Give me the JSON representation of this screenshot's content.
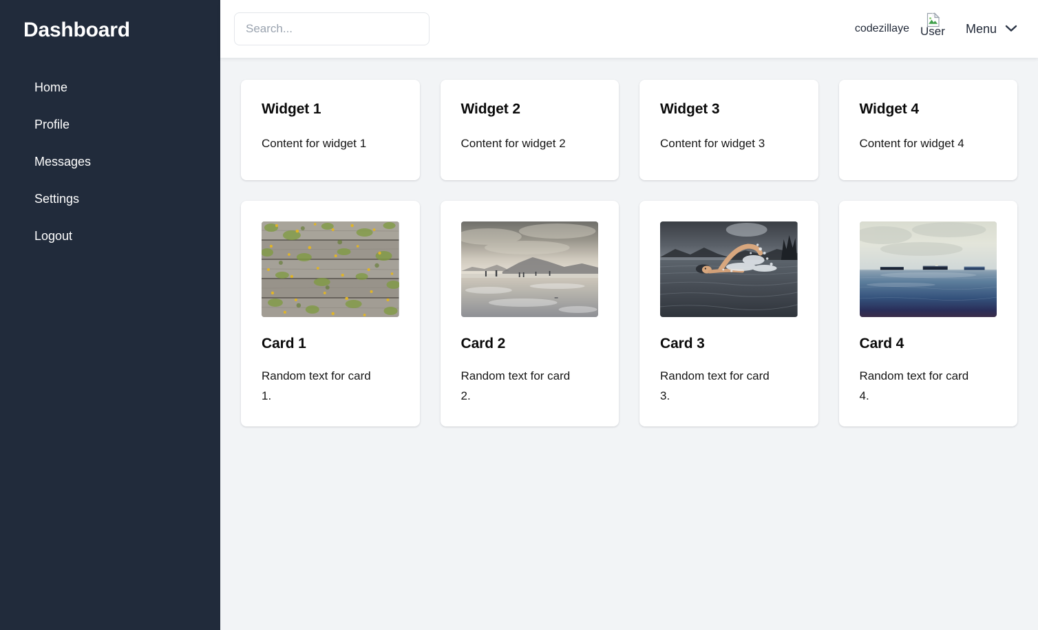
{
  "sidebar": {
    "title": "Dashboard",
    "items": [
      {
        "label": "Home"
      },
      {
        "label": "Profile"
      },
      {
        "label": "Messages"
      },
      {
        "label": "Settings"
      },
      {
        "label": "Logout"
      }
    ]
  },
  "header": {
    "search": {
      "placeholder": "Search...",
      "value": ""
    },
    "username": "codezillaye",
    "avatar": {
      "alt_text": "User",
      "icon": "broken-image-icon"
    },
    "menu": {
      "label": "Menu",
      "icon": "chevron-down-icon"
    }
  },
  "widgets": [
    {
      "title": "Widget 1",
      "body": "Content for widget 1"
    },
    {
      "title": "Widget 2",
      "body": "Content for widget 2"
    },
    {
      "title": "Widget 3",
      "body": "Content for widget 3"
    },
    {
      "title": "Widget 4",
      "body": "Content for widget 4"
    }
  ],
  "cards": [
    {
      "title": "Card 1",
      "body": "Random text for card 1.",
      "image_description": "Weathered gray wooden planks covered with yellow and green moss and lichen"
    },
    {
      "title": "Card 2",
      "body": "Random text for card 2.",
      "image_description": "Overcast beach with distant mountains and small figures walking on wet sand"
    },
    {
      "title": "Card 3",
      "body": "Random text for card 3.",
      "image_description": "Swimmer doing freestyle stroke in a dark lake under a stormy sky"
    },
    {
      "title": "Card 4",
      "body": "Random text for card 4.",
      "image_description": "Three distant cargo ships on a calm blue sea under a pale sky"
    }
  ],
  "colors": {
    "sidebar_bg": "#212b3b",
    "page_bg": "#f2f4f6",
    "header_bg": "#ffffff",
    "card_bg": "#ffffff",
    "text_dark": "#1f2736",
    "placeholder": "#9aa3af"
  }
}
